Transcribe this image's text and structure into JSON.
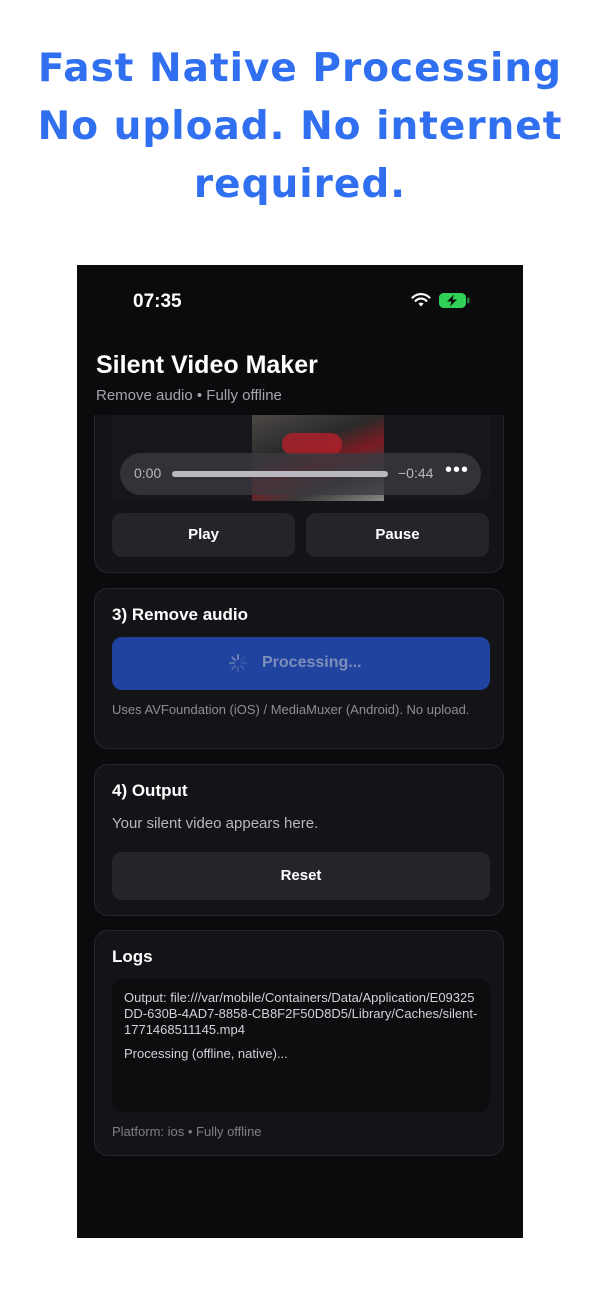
{
  "headline": {
    "line1": "Fast Native Processing",
    "line2": "No upload. No internet",
    "line3": "required."
  },
  "status_bar": {
    "time": "07:35",
    "icons": [
      "wifi-icon",
      "battery-charging-icon"
    ],
    "battery_color": "#30d158"
  },
  "app": {
    "title": "Silent Video Maker",
    "subtitle": "Remove audio • Fully offline"
  },
  "player": {
    "current_time": "0:00",
    "remaining_time": "−0:44",
    "more_label": "•••",
    "play_label": "Play",
    "pause_label": "Pause"
  },
  "remove_audio": {
    "title": "3) Remove audio",
    "button_label": "Processing...",
    "button_color": "#2143a0",
    "note": "Uses AVFoundation (iOS) / MediaMuxer (Android). No upload."
  },
  "output": {
    "title": "4) Output",
    "text": "Your silent video appears here.",
    "reset_label": "Reset"
  },
  "logs": {
    "title": "Logs",
    "lines": [
      "Output: file:///var/mobile/Containers/Data/Application/E09325DD-630B-4AD7-8858-CB8F2F50D8D5/Library/Caches/silent-1771468511145.mp4",
      "Processing (offline, native)..."
    ],
    "platform": "Platform: ios • Fully offline"
  },
  "colors": {
    "accent": "#2f6ff0",
    "background": "#0b0b0e",
    "card": "#141418"
  }
}
